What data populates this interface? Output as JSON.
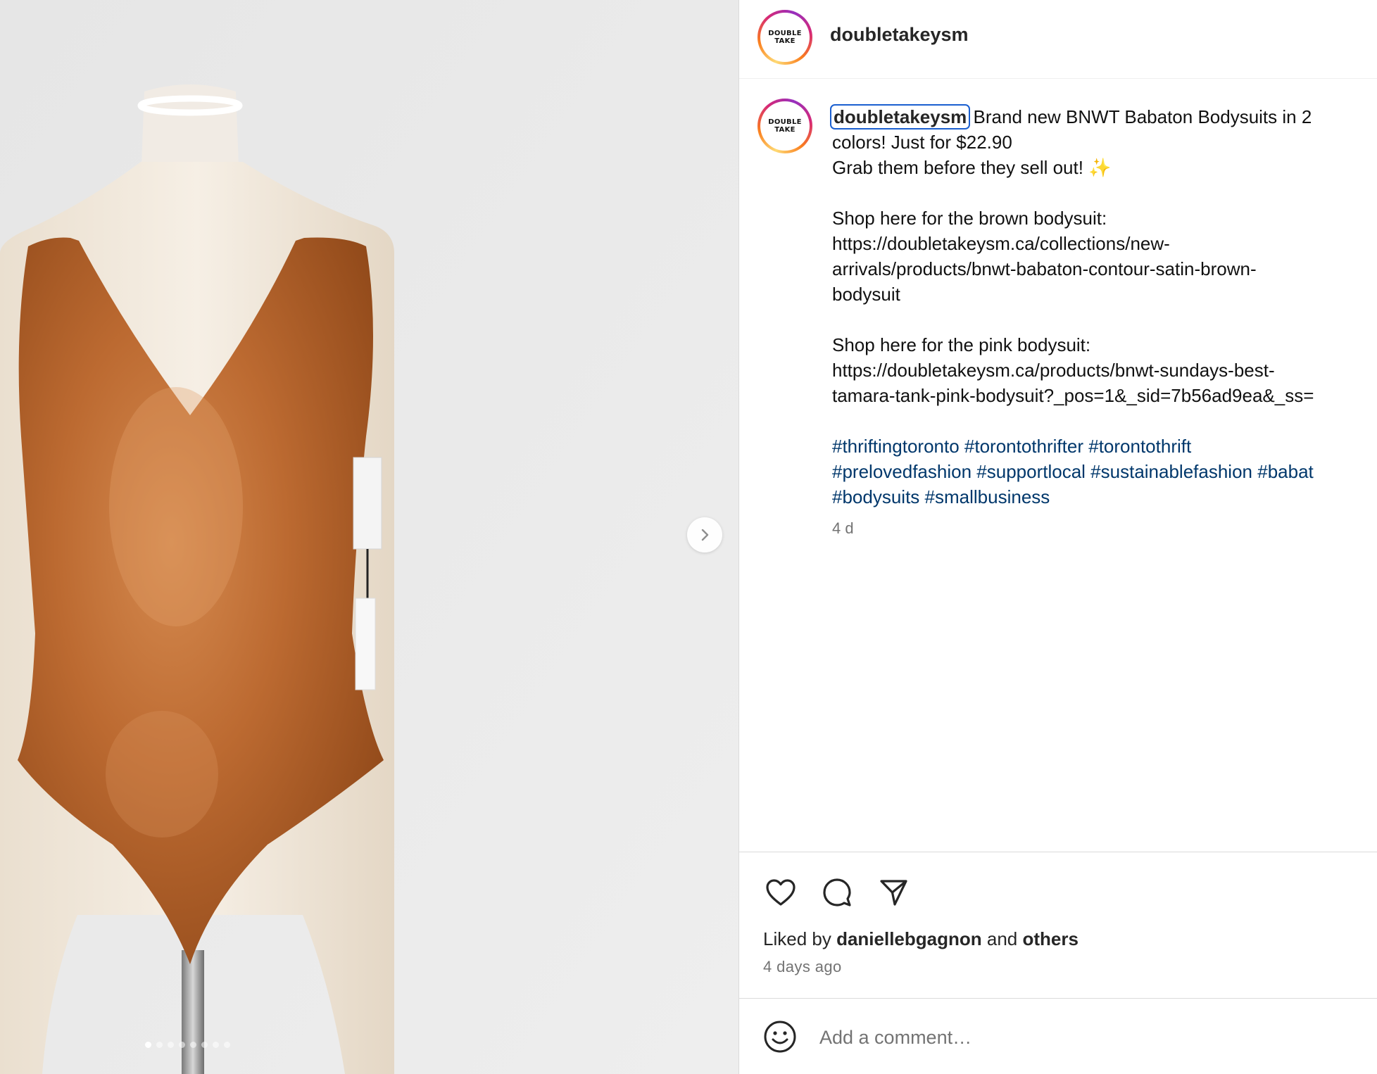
{
  "post": {
    "username": "doubletakeysm",
    "avatar_text": "DOUBLE\nTAKE",
    "caption": {
      "username": "doubletakeysm",
      "line1": "Brand new BNWT Babaton Bodysuits in 2",
      "line2": "colors! Just for $22.90",
      "line3": "Grab them before they sell out! ",
      "sparkle": "✨",
      "brown_heading": "Shop here for the brown bodysuit:",
      "brown_link_1": "https://doubletakeysm.ca/collections/new-",
      "brown_link_2": "arrivals/products/bnwt-babaton-contour-satin-brown-",
      "brown_link_3": "bodysuit",
      "pink_heading": "Shop here for the pink bodysuit:",
      "pink_link_1": "https://doubletakeysm.ca/products/bnwt-sundays-best-",
      "pink_link_2": "tamara-tank-pink-bodysuit?_pos=1&_sid=7b56ad9ea&_ss=",
      "hashtags_line1": [
        "#thriftingtoronto",
        "#torontothrifter",
        "#torontothrift"
      ],
      "hashtags_line2": [
        "#prelovedfashion",
        "#supportlocal",
        "#sustainablefashion",
        "#babat"
      ],
      "hashtags_line3": [
        "#bodysuits",
        "#smallbusiness"
      ]
    },
    "age": "4 d"
  },
  "actions": {
    "icons": [
      "heart-icon",
      "comment-icon",
      "share-icon"
    ],
    "liked_by_prefix": "Liked by ",
    "liked_by_user": "daniellebgagnon",
    "liked_by_mid": " and ",
    "liked_by_others": "others",
    "time": "4 days ago"
  },
  "comment": {
    "placeholder": "Add a comment…",
    "emoji_icon": "smiley-icon"
  },
  "carousel": {
    "dot_count": 8,
    "active_index": 0
  },
  "colors": {
    "hashtag": "#00376b",
    "focus_outline": "#1a5fd0",
    "bodysuit": "#b8662e"
  }
}
